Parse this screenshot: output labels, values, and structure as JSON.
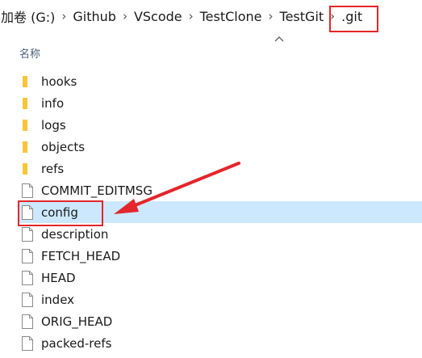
{
  "breadcrumb": [
    "加卷 (G:)",
    "Github",
    "VScode",
    "TestClone",
    "TestGit",
    ".git"
  ],
  "column_header": "名称",
  "files": [
    {
      "name": "hooks",
      "type": "folder"
    },
    {
      "name": "info",
      "type": "folder"
    },
    {
      "name": "logs",
      "type": "folder"
    },
    {
      "name": "objects",
      "type": "folder"
    },
    {
      "name": "refs",
      "type": "folder"
    },
    {
      "name": "COMMIT_EDITMSG",
      "type": "file"
    },
    {
      "name": "config",
      "type": "file",
      "selected": true
    },
    {
      "name": "description",
      "type": "file"
    },
    {
      "name": "FETCH_HEAD",
      "type": "file"
    },
    {
      "name": "HEAD",
      "type": "file"
    },
    {
      "name": "index",
      "type": "file"
    },
    {
      "name": "ORIG_HEAD",
      "type": "file"
    },
    {
      "name": "packed-refs",
      "type": "file"
    }
  ],
  "colors": {
    "selection": "#cce8ff",
    "annotation": "#e3262b",
    "folder": "#f8c53a",
    "header_text": "#4c607a"
  },
  "icons": {
    "folder": "folder-icon",
    "file": "file-icon",
    "separator": "chevron-right-icon",
    "sort": "chevron-up-icon"
  }
}
